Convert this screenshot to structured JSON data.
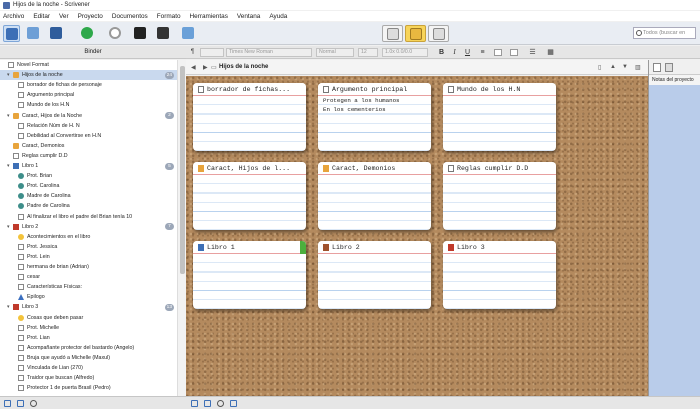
{
  "window": {
    "title": "Hijos de la noche - Scrivener"
  },
  "menu": [
    "Archivo",
    "Editar",
    "Ver",
    "Proyecto",
    "Documentos",
    "Formato",
    "Herramientas",
    "Ventana",
    "Ayuda"
  ],
  "search": {
    "placeholder": "Todos (buscar en"
  },
  "binder": {
    "title": "Binder",
    "items": [
      {
        "label": "Novel Format",
        "icon": "manuscript-icon",
        "indent": 0,
        "arrow": "",
        "badge": ""
      },
      {
        "label": "Hijos de la noche",
        "icon": "folder-icon",
        "indent": 1,
        "arrow": "▾",
        "badge": "24",
        "selected": true
      },
      {
        "label": "borrador de fichas de personaje",
        "icon": "document-icon",
        "indent": 2,
        "arrow": "",
        "badge": ""
      },
      {
        "label": "Argumento principal",
        "icon": "document-icon",
        "indent": 2,
        "arrow": "",
        "badge": ""
      },
      {
        "label": "Mundo de los H.N",
        "icon": "document-icon",
        "indent": 2,
        "arrow": "",
        "badge": ""
      },
      {
        "label": "Caract, Hijos de la Noche",
        "icon": "folder-icon",
        "indent": 1,
        "arrow": "▾",
        "badge": "2"
      },
      {
        "label": "Relación Núm de H. N",
        "icon": "document-icon",
        "indent": 2,
        "arrow": "",
        "badge": ""
      },
      {
        "label": "Debilidad al Convertirse en H.N",
        "icon": "document-icon",
        "indent": 2,
        "arrow": "",
        "badge": ""
      },
      {
        "label": "Caract, Demonios",
        "icon": "folder-icon",
        "indent": 1,
        "arrow": "",
        "badge": ""
      },
      {
        "label": "Reglas cumplir D.D",
        "icon": "document-icon",
        "indent": 1,
        "arrow": "",
        "badge": ""
      },
      {
        "label": "Libro 1",
        "icon": "book-blue-icon",
        "indent": 1,
        "arrow": "▾",
        "badge": "5"
      },
      {
        "label": "Prot. Brian",
        "icon": "eye-icon",
        "indent": 2,
        "arrow": "",
        "badge": ""
      },
      {
        "label": "Prot. Carolina",
        "icon": "eye-icon",
        "indent": 2,
        "arrow": "",
        "badge": ""
      },
      {
        "label": "Madre de Carolina",
        "icon": "eye-icon",
        "indent": 2,
        "arrow": "",
        "badge": ""
      },
      {
        "label": "Padre de Carolina",
        "icon": "eye-icon",
        "indent": 2,
        "arrow": "",
        "badge": ""
      },
      {
        "label": "Al finalizar el libro el padre del Brian tenía 10",
        "icon": "document-icon",
        "indent": 2,
        "arrow": "",
        "badge": ""
      },
      {
        "label": "Libro 2",
        "icon": "book-red-icon",
        "indent": 1,
        "arrow": "▾",
        "badge": "7"
      },
      {
        "label": "Acontecimientos en el libro",
        "icon": "star-icon",
        "indent": 2,
        "arrow": "",
        "badge": ""
      },
      {
        "label": "Prot. Jessica",
        "icon": "document-icon",
        "indent": 2,
        "arrow": "",
        "badge": ""
      },
      {
        "label": "Prot. Lein",
        "icon": "document-icon",
        "indent": 2,
        "arrow": "",
        "badge": ""
      },
      {
        "label": "hermana de brian (Adrian)",
        "icon": "document-icon",
        "indent": 2,
        "arrow": "",
        "badge": ""
      },
      {
        "label": "cesar",
        "icon": "document-icon",
        "indent": 2,
        "arrow": "",
        "badge": ""
      },
      {
        "label": "Características Físicas:",
        "icon": "document-icon",
        "indent": 2,
        "arrow": "",
        "badge": ""
      },
      {
        "label": "Epilogo",
        "icon": "triangle-icon",
        "indent": 2,
        "arrow": "",
        "badge": ""
      },
      {
        "label": "Libro 3",
        "icon": "book-red-icon",
        "indent": 1,
        "arrow": "▾",
        "badge": "13"
      },
      {
        "label": "Cosas que deben pasar",
        "icon": "star-icon",
        "indent": 2,
        "arrow": "",
        "badge": ""
      },
      {
        "label": "Prot. Michelle",
        "icon": "document-icon",
        "indent": 2,
        "arrow": "",
        "badge": ""
      },
      {
        "label": "Prot. Lian",
        "icon": "document-icon",
        "indent": 2,
        "arrow": "",
        "badge": ""
      },
      {
        "label": "Acompañante protector del bastardo (Angelo)",
        "icon": "document-icon",
        "indent": 2,
        "arrow": "",
        "badge": ""
      },
      {
        "label": "Bruja que ayudó a Michelle (Maxul)",
        "icon": "document-icon",
        "indent": 2,
        "arrow": "",
        "badge": ""
      },
      {
        "label": "Vinculada de Lian (270)",
        "icon": "document-icon",
        "indent": 2,
        "arrow": "",
        "badge": ""
      },
      {
        "label": "Traidor que buscan (Alfredo)",
        "icon": "document-icon",
        "indent": 2,
        "arrow": "",
        "badge": ""
      },
      {
        "label": "Protector 1 de puerta Brasil (Pedro)",
        "icon": "document-icon",
        "indent": 2,
        "arrow": "",
        "badge": ""
      }
    ]
  },
  "format": {
    "font": "Times New Roman",
    "style": "Normal",
    "size": "12",
    "spacing": "1.0x 0.0/0.0"
  },
  "editor": {
    "title": "Hijos de la noche"
  },
  "cards": [
    {
      "title": "borrador de fichas...",
      "body": [],
      "icon": "doc",
      "tag": false
    },
    {
      "title": "Argumento principal",
      "body": [
        "Protegen a los humanos",
        "En los cementerios"
      ],
      "icon": "doc",
      "tag": false
    },
    {
      "title": "Mundo de los H.N",
      "body": [],
      "icon": "doc",
      "tag": false
    },
    {
      "title": "Caract, Hijos de l...",
      "body": [],
      "icon": "folder",
      "tag": false
    },
    {
      "title": "Caract, Demonios",
      "body": [],
      "icon": "folder",
      "tag": false
    },
    {
      "title": "Reglas cumplir D.D",
      "body": [],
      "icon": "doc",
      "tag": false
    },
    {
      "title": "Libro 1",
      "body": [],
      "icon": "book-blue",
      "tag": true
    },
    {
      "title": "Libro 2",
      "body": [],
      "icon": "book-brown",
      "tag": false
    },
    {
      "title": "Libro 3",
      "body": [],
      "icon": "book-red",
      "tag": false
    }
  ],
  "inspector": {
    "title": "Notas del proyecto"
  },
  "colors": {
    "corkboard": "#b48a5e",
    "inspector": "#b9ccea",
    "selection": "#c9d9ee",
    "accent": "#3d6fb6"
  }
}
